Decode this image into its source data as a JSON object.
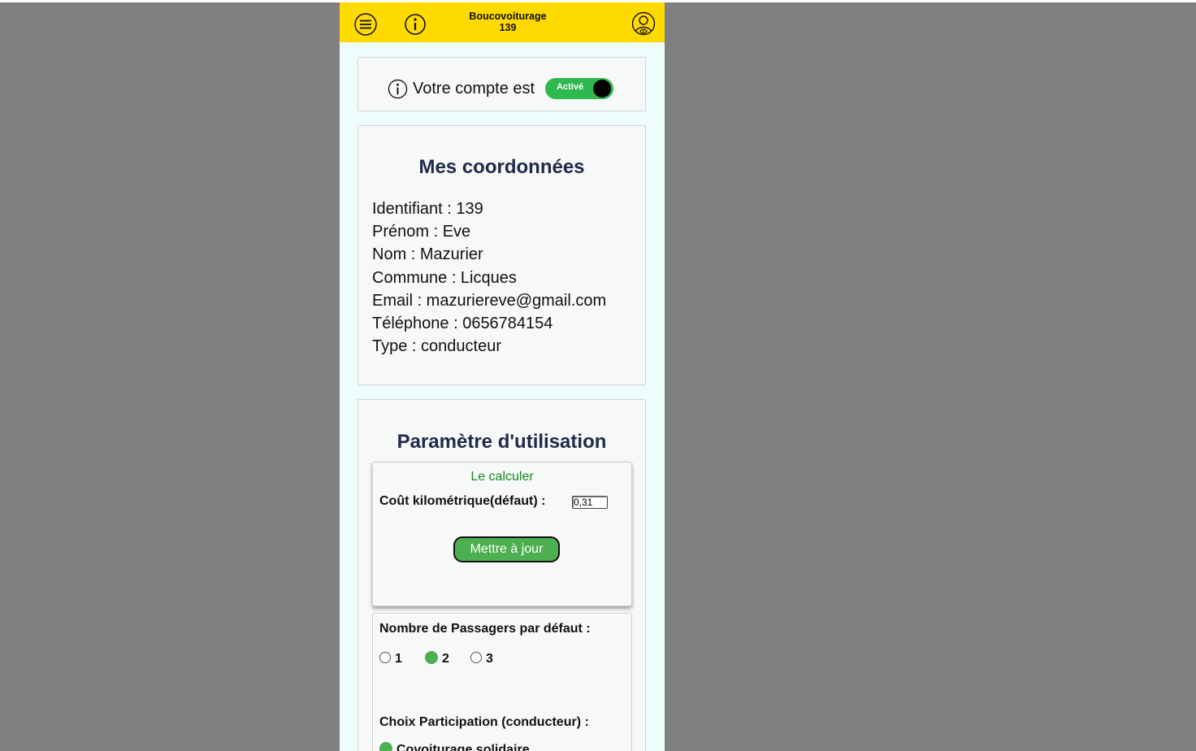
{
  "header": {
    "title_line1": "Boucovoiturage",
    "title_line2": "139",
    "menu_icon": "hamburger-menu-icon",
    "info_icon": "info-icon",
    "user_icon": "user-account-icon"
  },
  "account": {
    "status_text": "Votre compte est",
    "toggle_label": "Activé",
    "active": true
  },
  "coords": {
    "title": "Mes coordonnées",
    "lines": [
      "Identifiant : 139",
      "Prénom : Eve",
      "Nom : Mazurier",
      "Commune : Licques",
      "Email : mazuriereve@gmail.com",
      "Téléphone : 0656784154",
      "Type : conducteur"
    ]
  },
  "params": {
    "title": "Paramètre d'utilisation",
    "calc_link": "Le calculer",
    "cost_label": "Coût kilométrique(défaut) :",
    "cost_value": "0,31",
    "update_button": "Mettre à jour",
    "passengers_label": "Nombre de Passagers par défaut :",
    "passenger_options": [
      "1",
      "2",
      "3"
    ],
    "passenger_selected": "2",
    "participation_label": "Choix Participation (conducteur) :",
    "participation_option": "Covoiturage solidaire"
  },
  "colors": {
    "header_bg": "#ffda00",
    "page_bg": "#808080",
    "accent_green": "#4caf50",
    "title_navy": "#1f2a4a"
  }
}
